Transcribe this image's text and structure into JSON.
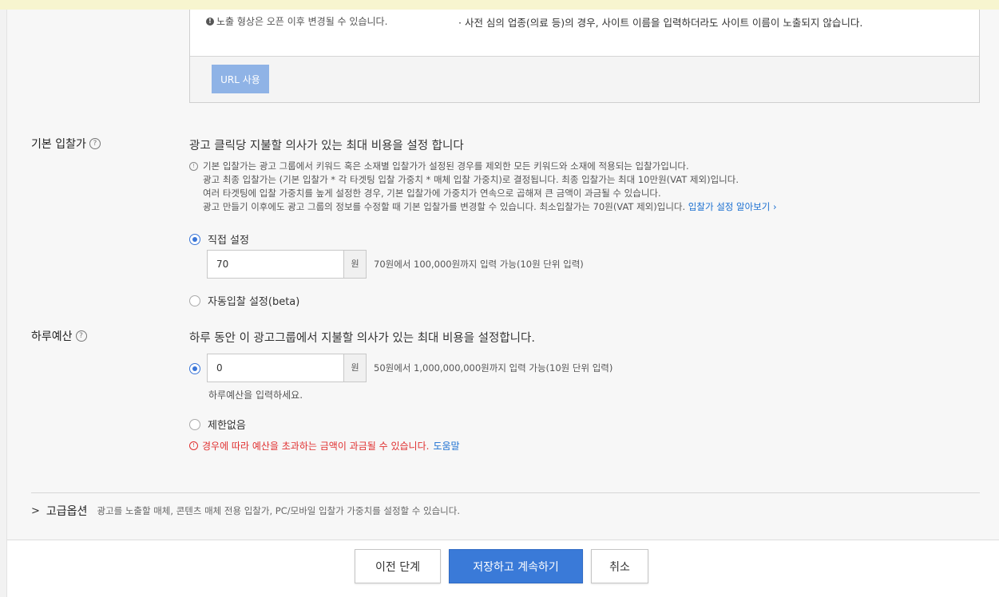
{
  "url_section": {
    "note_left": "노출 형상은 오픈 이후 변경될 수 있습니다.",
    "note_right": "· 사전 심의 업종(의료 등)의 경우, 사이트 이름을 입력하더라도 사이트 이름이 노출되지 않습니다.",
    "url_button": "URL 사용"
  },
  "bid": {
    "label": "기본 입찰가",
    "title": "광고 클릭당 지불할 의사가 있는 최대 비용을 설정 합니다",
    "help_lines": [
      "기본 입찰가는 광고 그룹에서 키워드 혹은 소재별 입찰가가 설정된 경우를 제외한 모든 키워드와 소재에 적용되는 입찰가입니다.",
      "광고 최종 입찰가는 (기본 입찰가 * 각 타겟팅 입찰 가중치 * 매체 입찰 가중치)로 결정됩니다. 최종 입찰가는 최대 10만원(VAT 제외)입니다.",
      "여러 타겟팅에 입찰 가중치를 높게 설정한 경우, 기본 입찰가에 가중치가 연속으로 곱해져 큰 금액이 과금될 수 있습니다.",
      "광고 만들기 이후에도 광고 그룹의 정보를 수정할 때 기본 입찰가를 변경할 수 있습니다. 최소입찰가는 70원(VAT 제외)입니다."
    ],
    "help_link": "입찰가 설정 알아보기 ›",
    "manual_label": "직접 설정",
    "manual_value": "70",
    "unit": "원",
    "range": "70원에서 100,000원까지 입력 가능(10원 단위 입력)",
    "auto_label": "자동입찰 설정(beta)"
  },
  "budget": {
    "label": "하루예산",
    "title": "하루 동안 이 광고그룹에서 지불할 의사가 있는 최대 비용을 설정합니다.",
    "value": "0",
    "unit": "원",
    "range": "50원에서 1,000,000,000원까지 입력 가능(10원 단위 입력)",
    "hint": "하루예산을 입력하세요.",
    "unlimited_label": "제한없음",
    "warning": "경우에 따라 예산을 초과하는 금액이 과금될 수 있습니다.",
    "warning_link": "도움말"
  },
  "advanced": {
    "title": "고급옵션",
    "description": "광고를 노출할 매체, 콘텐츠 매체 전용 입찰가, PC/모바일 입찰가 가중치를 설정할 수 있습니다."
  },
  "footer": {
    "prev": "이전 단계",
    "save": "저장하고 계속하기",
    "cancel": "취소"
  },
  "colors": {
    "primary": "#3a7ad8",
    "link": "#1a6fd1",
    "warning": "#e03030"
  }
}
